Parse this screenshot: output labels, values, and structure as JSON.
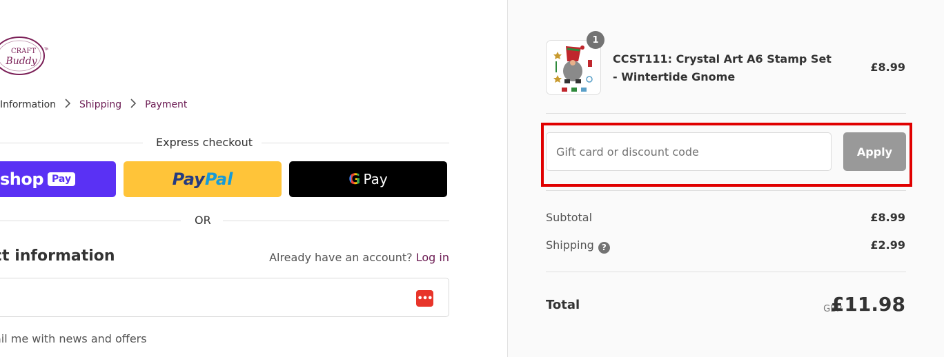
{
  "brand": {
    "logo_line1": "CRAFT",
    "logo_line2": "Buddy",
    "logo_tm": "TM",
    "accent_color": "#6b1a52"
  },
  "breadcrumb": {
    "items": [
      {
        "label": "Information",
        "active": true
      },
      {
        "label": "Shipping",
        "active": false
      },
      {
        "label": "Payment",
        "active": false
      }
    ]
  },
  "express": {
    "title": "Express checkout",
    "shop_pay": {
      "word": "shop",
      "badge": "Pay"
    },
    "paypal": {
      "part1": "Pay",
      "part2": "Pal"
    },
    "gpay": {
      "g": "G",
      "label": "Pay"
    },
    "or_label": "OR"
  },
  "contact": {
    "title": "ct information",
    "account_prompt": "Already have an account?",
    "login_link": "Log in",
    "email_value": "",
    "password_icon": "password-manager-icon",
    "newsletter_label": "ail me with news and offers"
  },
  "order": {
    "item": {
      "quantity": "1",
      "title": "CCST111: Crystal Art A6 Stamp Set - Wintertide Gnome",
      "price": "£8.99",
      "image": "gnome-stamp-set"
    },
    "discount": {
      "placeholder": "Gift card or discount code",
      "value": "",
      "apply_label": "Apply"
    },
    "subtotal": {
      "label": "Subtotal",
      "value": "£8.99"
    },
    "shipping": {
      "label": "Shipping",
      "help_icon": "?",
      "value": "£2.99"
    },
    "total": {
      "label": "Total",
      "currency": "GBP",
      "value": "£11.98"
    }
  }
}
